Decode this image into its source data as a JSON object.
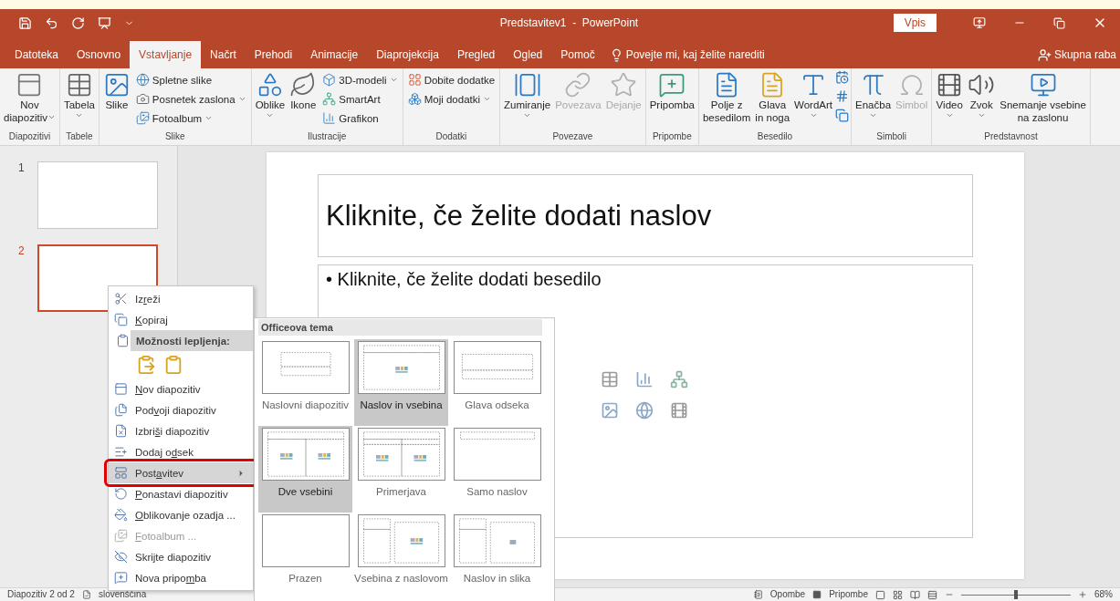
{
  "title_bar": {
    "title": "Predstavitev1  -  PowerPoint",
    "sign_in": "Vpis"
  },
  "tabs": [
    {
      "label": "Datoteka",
      "selected": false
    },
    {
      "label": "Osnovno",
      "selected": false
    },
    {
      "label": "Vstavljanje",
      "selected": true
    },
    {
      "label": "Načrt",
      "selected": false
    },
    {
      "label": "Prehodi",
      "selected": false
    },
    {
      "label": "Animacije",
      "selected": false
    },
    {
      "label": "Diaprojekcija",
      "selected": false
    },
    {
      "label": "Pregled",
      "selected": false
    },
    {
      "label": "Ogled",
      "selected": false
    },
    {
      "label": "Pomoč",
      "selected": false
    }
  ],
  "tell_me": "Povejte mi, kaj želite narediti",
  "share": "Skupna raba",
  "ribbon": {
    "groups": [
      {
        "label": "Diapozitivi",
        "items": [
          {
            "kind": "large",
            "label": "Nov\ndiapozitiv",
            "dropdown": true,
            "disabled": false
          }
        ]
      },
      {
        "label": "Tabele",
        "items": [
          {
            "kind": "large",
            "label": "Tabela",
            "dropdown": true,
            "disabled": false
          }
        ]
      },
      {
        "label": "Slike",
        "items": [
          {
            "kind": "large",
            "label": "Slike",
            "dropdown": false,
            "disabled": false
          },
          {
            "kind": "column",
            "items": [
              {
                "label": "Spletne slike",
                "dropdown": false
              },
              {
                "label": "Posnetek zaslona",
                "dropdown": true
              },
              {
                "label": "Fotoalbum",
                "dropdown": true
              }
            ]
          }
        ]
      },
      {
        "label": "Ilustracije",
        "items": [
          {
            "kind": "large",
            "label": "Oblike",
            "dropdown": true,
            "disabled": false
          },
          {
            "kind": "large",
            "label": "Ikone",
            "dropdown": false,
            "disabled": false
          },
          {
            "kind": "column",
            "items": [
              {
                "label": "3D-modeli",
                "dropdown": true
              },
              {
                "label": "SmartArt",
                "dropdown": false
              },
              {
                "label": "Grafikon",
                "dropdown": false
              }
            ]
          }
        ]
      },
      {
        "label": "Dodatki",
        "items": [
          {
            "kind": "column",
            "items": [
              {
                "label": "Dobite dodatke",
                "dropdown": false
              },
              {
                "label": "Moji dodatki",
                "dropdown": true
              }
            ]
          }
        ]
      },
      {
        "label": "Povezave",
        "items": [
          {
            "kind": "large",
            "label": "Zumiranje",
            "dropdown": true,
            "disabled": false
          },
          {
            "kind": "large",
            "label": "Povezava",
            "dropdown": false,
            "disabled": true
          },
          {
            "kind": "large",
            "label": "Dejanje",
            "dropdown": false,
            "disabled": true
          }
        ]
      },
      {
        "label": "Pripombe",
        "items": [
          {
            "kind": "large",
            "label": "Pripomba",
            "dropdown": false,
            "disabled": false
          }
        ]
      },
      {
        "label": "Besedilo",
        "items": [
          {
            "kind": "large",
            "label": "Polje z\nbesedilom",
            "dropdown": false,
            "disabled": false
          },
          {
            "kind": "large",
            "label": "Glava\nin noga",
            "dropdown": false,
            "disabled": false
          },
          {
            "kind": "large",
            "label": "WordArt",
            "dropdown": true,
            "disabled": false
          },
          {
            "kind": "icons"
          }
        ]
      },
      {
        "label": "Simboli",
        "items": [
          {
            "kind": "large",
            "label": "Enačba",
            "dropdown": true,
            "disabled": false
          },
          {
            "kind": "large",
            "label": "Simbol",
            "dropdown": false,
            "disabled": true
          }
        ]
      },
      {
        "label": "Predstavnost",
        "items": [
          {
            "kind": "large",
            "label": "Video",
            "dropdown": true,
            "disabled": false
          },
          {
            "kind": "large",
            "label": "Zvok",
            "dropdown": true,
            "disabled": false
          },
          {
            "kind": "large",
            "label": "Snemanje vsebine\nna zaslonu",
            "dropdown": false,
            "disabled": false
          }
        ]
      }
    ]
  },
  "thumbnails": [
    {
      "number": "1",
      "selected": false
    },
    {
      "number": "2",
      "selected": true
    }
  ],
  "slide": {
    "title_placeholder": "Kliknite, če želite dodati naslov",
    "bullet": "•",
    "body_placeholder": "Kliknite, če želite dodati besedilo"
  },
  "context_menu": {
    "items": [
      {
        "kind": "item",
        "pre": "Iz",
        "key": "r",
        "post": "eži",
        "disabled": false,
        "highlighted": false,
        "outlined": false
      },
      {
        "kind": "item",
        "key": "K",
        "post": "opiraj",
        "disabled": false,
        "highlighted": false,
        "outlined": false
      },
      {
        "kind": "header",
        "pre": "Možnosti lepljenja:"
      },
      {
        "kind": "paste_options"
      },
      {
        "kind": "item",
        "key": "N",
        "post": "ov diapozitiv",
        "disabled": false,
        "highlighted": false,
        "outlined": false
      },
      {
        "kind": "item",
        "pre": "Pod",
        "key": "v",
        "post": "oji diapozitiv",
        "disabled": false,
        "highlighted": false,
        "outlined": false
      },
      {
        "kind": "item",
        "pre": "Izbri",
        "key": "š",
        "post": "i diapozitiv",
        "disabled": false,
        "highlighted": false,
        "outlined": false
      },
      {
        "kind": "item",
        "pre": "Dodaj o",
        "key": "d",
        "post": "sek",
        "disabled": false,
        "highlighted": false,
        "outlined": false
      },
      {
        "kind": "submenu",
        "pre": "Post",
        "key": "a",
        "post": "vitev",
        "disabled": false,
        "highlighted": true,
        "outlined": true
      },
      {
        "kind": "item",
        "key": "P",
        "post": "onastavi diapozitiv",
        "disabled": false,
        "highlighted": false,
        "outlined": false
      },
      {
        "kind": "item",
        "key": "O",
        "post": "blikovanje ozadja ...",
        "disabled": false,
        "highlighted": false,
        "outlined": false
      },
      {
        "kind": "item",
        "key": "F",
        "post": "otoalbum ...",
        "disabled": true,
        "highlighted": false,
        "outlined": false
      },
      {
        "kind": "item",
        "pre": "Skrijte diapozitiv",
        "disabled": false,
        "highlighted": false,
        "outlined": false
      },
      {
        "kind": "item",
        "pre": "Nova pripo",
        "key": "m",
        "post": "ba",
        "disabled": false,
        "highlighted": false,
        "outlined": false
      }
    ]
  },
  "layout_gallery": {
    "title": "Officeova tema",
    "layouts": [
      {
        "kind": "title",
        "label": "Naslovni diapozitiv",
        "highlighted": false
      },
      {
        "kind": "title_content",
        "label": "Naslov in vsebina",
        "highlighted": true
      },
      {
        "kind": "section",
        "label": "Glava odseka",
        "highlighted": false
      },
      {
        "kind": "two_content",
        "label": "Dve vsebini",
        "highlighted": true
      },
      {
        "kind": "comparison",
        "label": "Primerjava",
        "highlighted": false
      },
      {
        "kind": "title_only",
        "label": "Samo naslov",
        "highlighted": false
      },
      {
        "kind": "blank",
        "label": "Prazen",
        "highlighted": false
      },
      {
        "kind": "content_caption",
        "label": "Vsebina z naslovom",
        "highlighted": false
      },
      {
        "kind": "picture_caption",
        "label": "Naslov in slika",
        "highlighted": false
      }
    ]
  },
  "status_bar": {
    "slide_count": "Diapozitiv 2 od 2",
    "language": "slovenščina",
    "notes": "Opombe",
    "comments": "Pripombe",
    "zoom": {
      "level": 0.5,
      "reading": "68%"
    }
  }
}
